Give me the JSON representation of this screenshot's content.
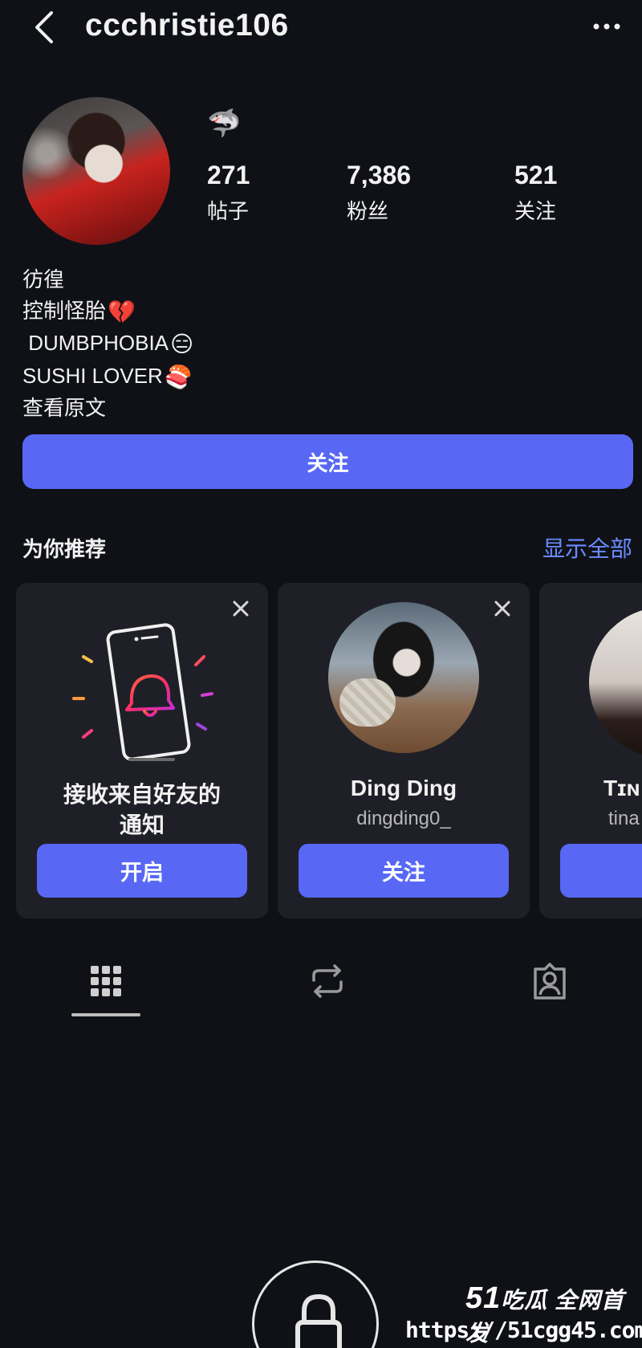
{
  "header": {
    "username": "ccchristie106"
  },
  "profile": {
    "badge_emoji": "🦈",
    "stats": [
      {
        "value": "271",
        "label": "帖子"
      },
      {
        "value": "7,386",
        "label": "粉丝"
      },
      {
        "value": "521",
        "label": "关注"
      }
    ],
    "bio": {
      "line1": "彷徨",
      "line2": "控制怪胎",
      "line2_emoji": "💔",
      "line3": " DUMBPHOBIA",
      "line3_emoji": "😑",
      "line4": "SUSHI LOVER",
      "line4_emoji": "🍣",
      "see_more": "查看原文"
    },
    "follow_label": "关注"
  },
  "suggestions": {
    "title": "为你推荐",
    "see_all": "显示全部",
    "cards": [
      {
        "title_line1": "接收来自好友的",
        "title_line2": "通知",
        "button": "开启"
      },
      {
        "name": "Ding Ding",
        "handle": "dingding0_",
        "button": "关注"
      },
      {
        "name": "Tɪɴ",
        "handle": "tina"
      }
    ]
  },
  "watermark": {
    "logo_num": "51",
    "logo_text": "吃瓜 全网首发",
    "url": "https://51cgg45.com"
  },
  "colors": {
    "background": "#0f1117",
    "accent": "#5868f5",
    "link": "#6b8cff",
    "card": "#1f2027"
  }
}
